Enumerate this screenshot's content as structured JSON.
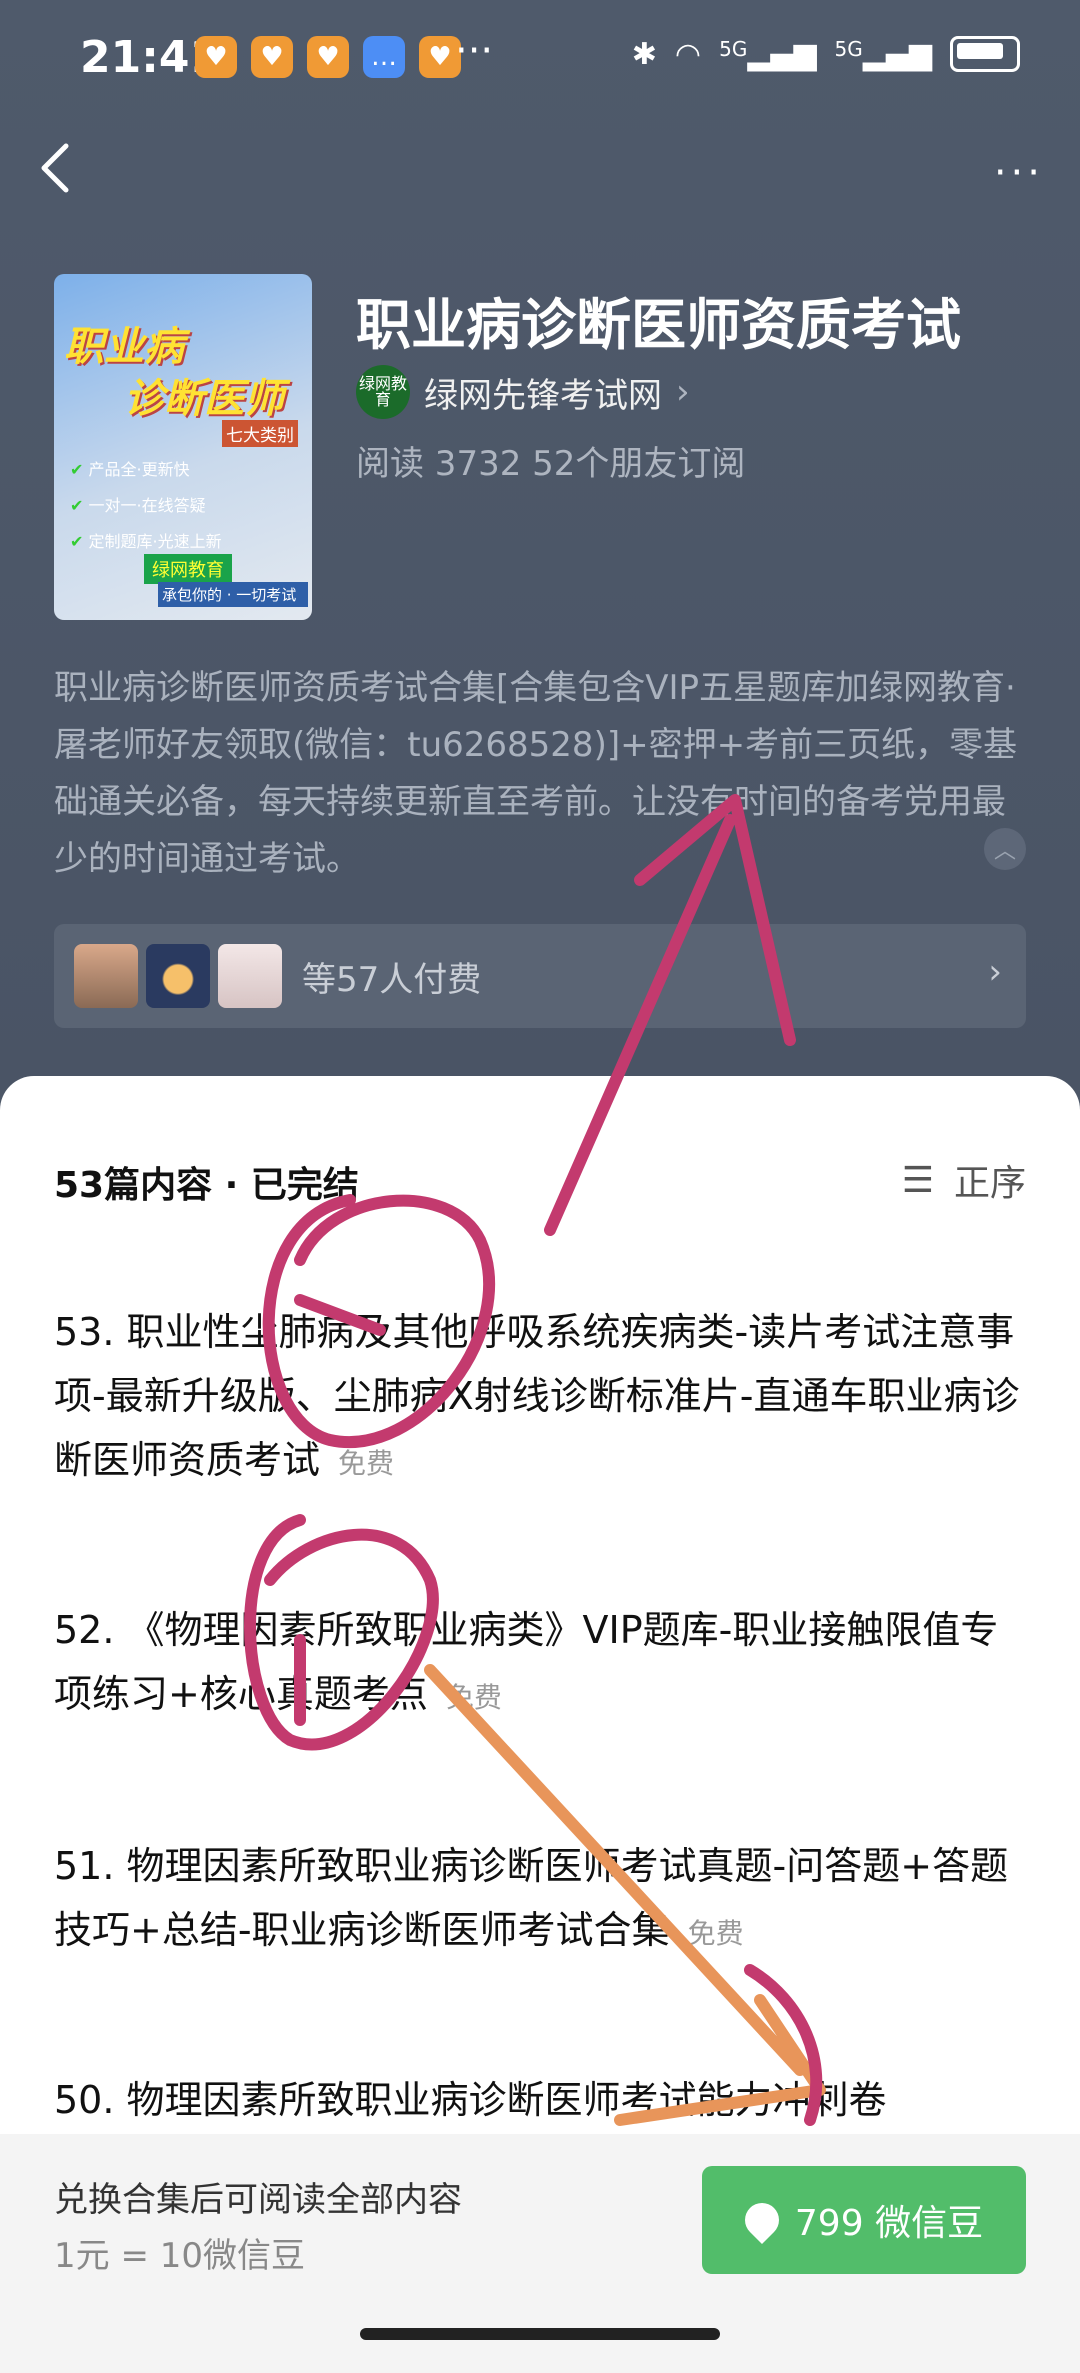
{
  "status": {
    "time": "21:41",
    "overflow": "···",
    "signal1": "5G",
    "signal2": "5G",
    "app_icons": [
      "notification-app-icon",
      "notification-app-icon",
      "notification-app-icon",
      "chat-app-icon",
      "notification-app-icon"
    ]
  },
  "nav": {
    "menu": "···"
  },
  "cover": {
    "line1": "职业病",
    "line2": "诊断医师",
    "tag": "七大类别",
    "bullets": [
      "产品全·更新快",
      "一对一·在线答疑",
      "定制题库·光速上新"
    ],
    "brand": "绿网教育",
    "slogan": "承包你的 · 一切考试"
  },
  "header": {
    "title": "职业病诊断医师资质考试",
    "author": "绿网先锋考试网",
    "author_logo": "绿网教育",
    "stats": "阅读 3732 52个朋友订阅"
  },
  "description": "职业病诊断医师资质考试合集[合集包含VIP五星题库加绿网教育·屠老师好友领取(微信：tu6268528)]+密押+考前三页纸，零基础通关必备，每天持续更新直至考前。让没有时间的备考党用最少的时间通过考试。",
  "payers": {
    "label": "等57人付费"
  },
  "sheet": {
    "count_label": "53篇内容 · 已完结",
    "sort_label": "正序",
    "items": [
      {
        "title": "53. 职业性尘肺病及其他呼吸系统疾病类-读片考试注意事项-最新升级版、尘肺病X射线诊断标准片-直通车职业病诊断医师资质考试",
        "badge": "免费"
      },
      {
        "title": "52. 《物理因素所致职业病类》VIP题库-职业接触限值专项练习+核心真题考点",
        "badge": "免费"
      },
      {
        "title": "51. 物理因素所致职业病诊断医师考试真题-问答题+答题技巧+总结-职业病诊断医师考试合集",
        "badge": "免费"
      },
      {
        "title": "50. 物理因素所致职业病诊断医师考试能力冲刺卷",
        "badge": ""
      }
    ]
  },
  "footer": {
    "line1": "兑换合集后可阅读全部内容",
    "line2": "1元 = 10微信豆",
    "button": "799 微信豆"
  },
  "colors": {
    "accent_green": "#52bd6a",
    "annotation_pink": "#c33a6e",
    "annotation_orange": "#e8955a"
  }
}
